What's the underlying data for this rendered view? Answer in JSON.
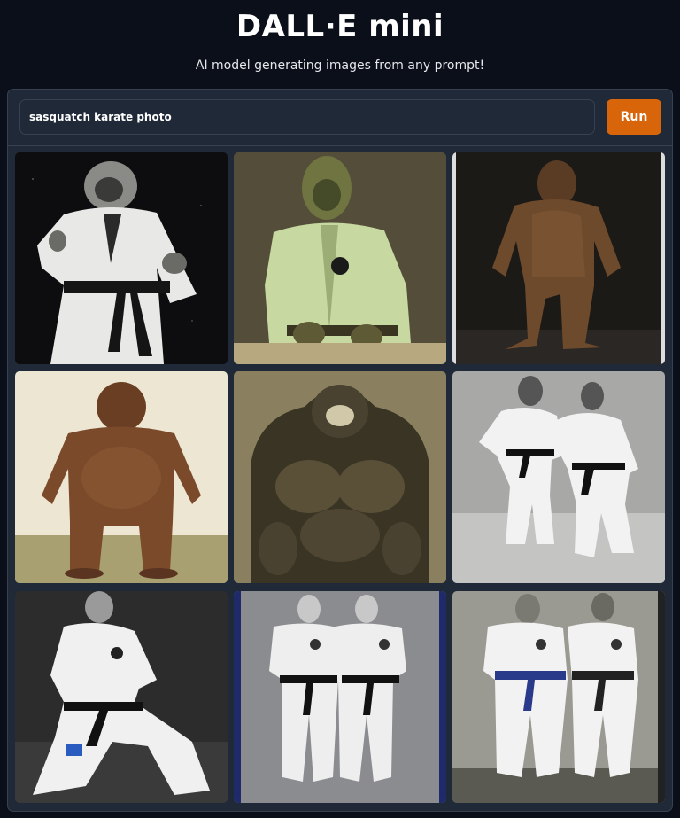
{
  "header": {
    "title": "DALL·E mini",
    "subtitle": "AI model generating images from any prompt!"
  },
  "prompt": {
    "value": "sasquatch karate photo",
    "placeholder": ""
  },
  "run_button": {
    "label": "Run"
  },
  "colors": {
    "background": "#0b0f19",
    "panel": "#1f2937",
    "border": "#374151",
    "accent": "#d9650a"
  },
  "gallery": {
    "images": [
      "sasquatch-in-white-gi-karate-stance",
      "sasquatch-in-pale-green-gi",
      "brown-sasquatch-walking",
      "brown-sasquatch-standing",
      "sasquatch-muscular-torso-closeup",
      "two-karateka-sparring",
      "karateka-low-stance",
      "two-karateka-standing-black-belts",
      "two-karateka-standing-blue-and-black-belts"
    ]
  }
}
